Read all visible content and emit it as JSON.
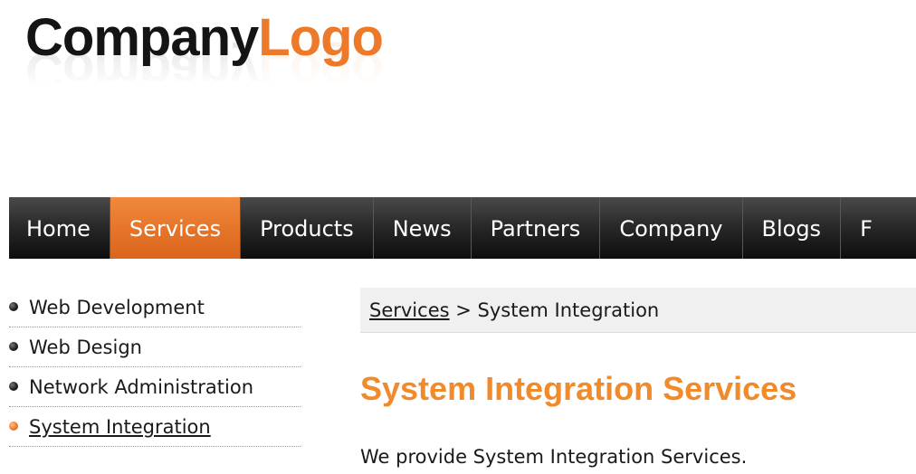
{
  "logo": {
    "part1": "Company",
    "part2": "Logo",
    "colors": {
      "dark": "#141414",
      "accent": "#ec7a2a"
    }
  },
  "nav": {
    "items": [
      {
        "label": "Home",
        "active": false
      },
      {
        "label": "Services",
        "active": true
      },
      {
        "label": "Products",
        "active": false
      },
      {
        "label": "News",
        "active": false
      },
      {
        "label": "Partners",
        "active": false
      },
      {
        "label": "Company",
        "active": false
      },
      {
        "label": "Blogs",
        "active": false
      },
      {
        "label": "F",
        "active": false
      }
    ],
    "active_color": "#e57328"
  },
  "sidebar": {
    "items": [
      {
        "label": "Web Development",
        "active": false,
        "icon": "bullet-icon"
      },
      {
        "label": "Web Design",
        "active": false,
        "icon": "bullet-icon"
      },
      {
        "label": "Network Administration",
        "active": false,
        "icon": "bullet-icon"
      },
      {
        "label": "System Integration",
        "active": true,
        "icon": "bullet-icon"
      }
    ]
  },
  "breadcrumb": {
    "link": "Services",
    "separator": ">",
    "current": "System Integration"
  },
  "content": {
    "title": "System Integration Services",
    "title_color": "#f08a2a",
    "body": "We provide System Integration Services."
  }
}
